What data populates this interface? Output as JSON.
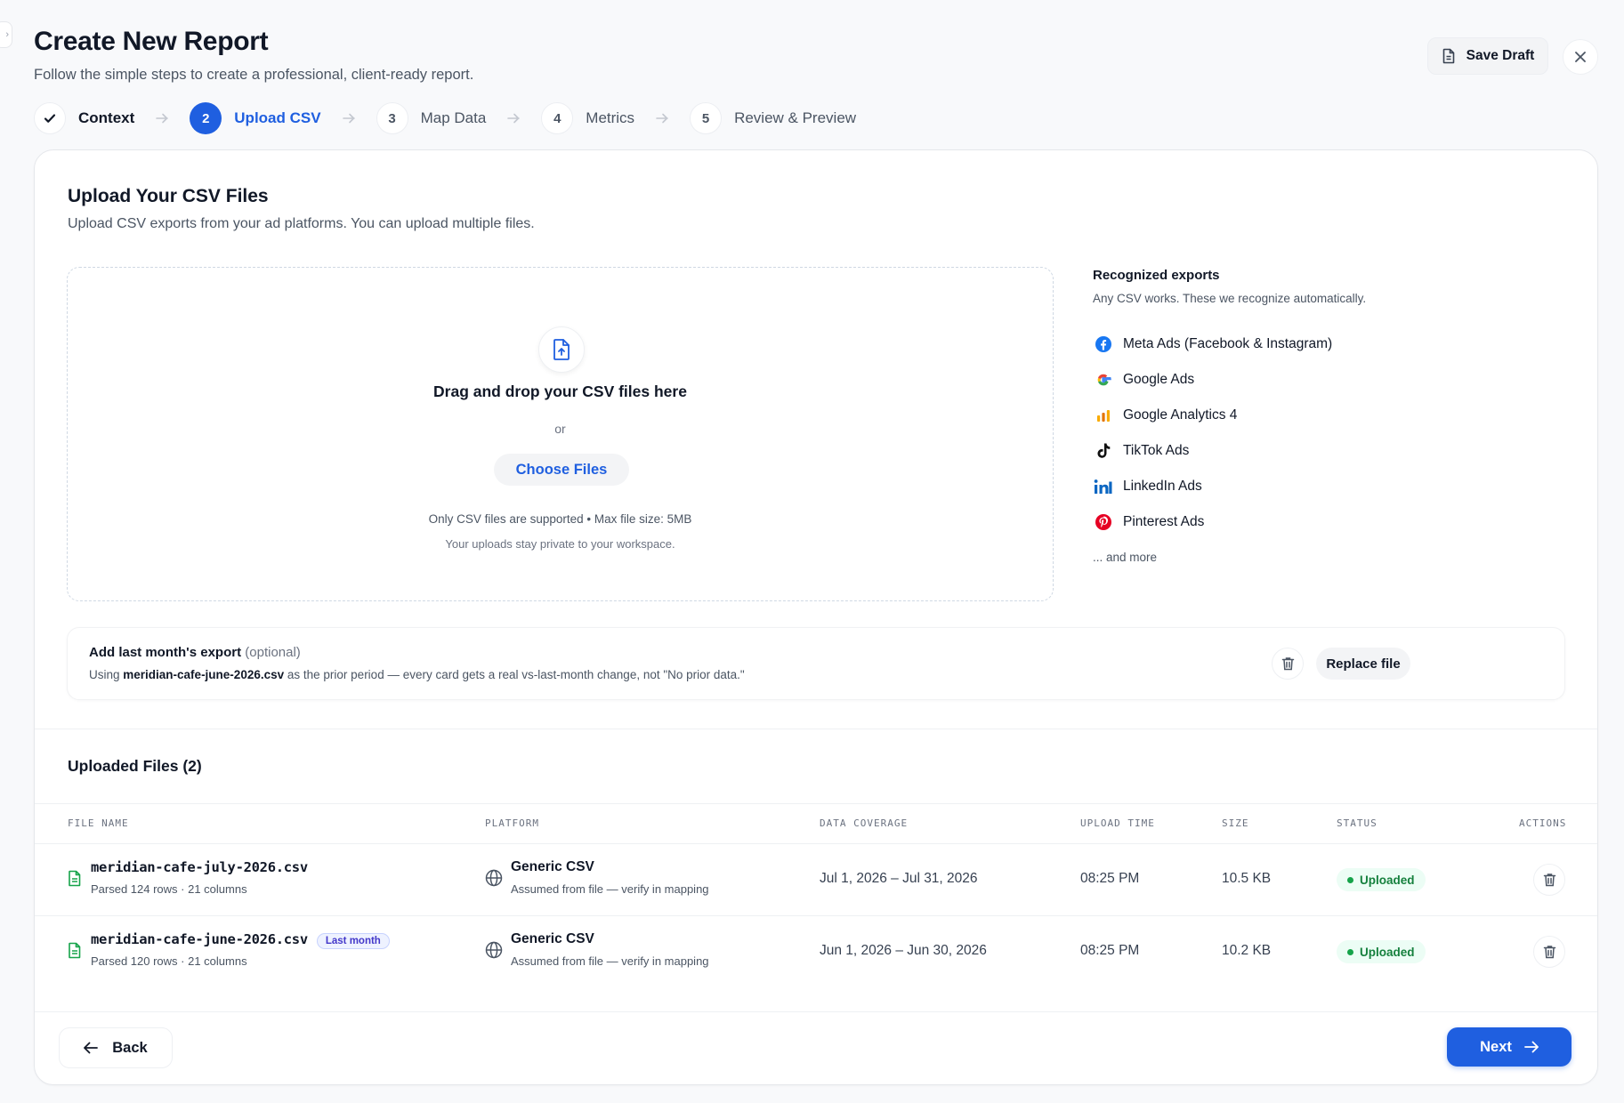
{
  "header": {
    "title": "Create New Report",
    "subtitle": "Follow the simple steps to create a professional, client-ready report.",
    "save_draft_label": "Save Draft",
    "close_icon": "close-icon"
  },
  "steps": [
    {
      "number": "✓",
      "label": "Context",
      "state": "done"
    },
    {
      "number": "2",
      "label": "Upload CSV",
      "state": "active"
    },
    {
      "number": "3",
      "label": "Map Data",
      "state": "pending"
    },
    {
      "number": "4",
      "label": "Metrics",
      "state": "pending"
    },
    {
      "number": "5",
      "label": "Review & Preview",
      "state": "pending"
    }
  ],
  "upload": {
    "title": "Upload Your CSV Files",
    "subtitle": "Upload CSV exports from your ad platforms. You can upload multiple files.",
    "dropzone": {
      "title": "Drag and drop your CSV files here",
      "or": "or",
      "choose_label": "Choose Files",
      "note_limits": "Only CSV files are supported • Max file size: 5MB",
      "note_privacy": "Your uploads stay private to your workspace."
    }
  },
  "recognized": {
    "title": "Recognized exports",
    "subtitle": "Any CSV works. These we recognize automatically.",
    "items": [
      {
        "label": "Meta Ads (Facebook & Instagram)",
        "icon": "meta-icon",
        "color": "#1877f2"
      },
      {
        "label": "Google Ads",
        "icon": "google-icon",
        "color": "#4285f4"
      },
      {
        "label": "Google Analytics 4",
        "icon": "analytics-icon",
        "color": "#f9ab00"
      },
      {
        "label": "TikTok Ads",
        "icon": "tiktok-icon",
        "color": "#111111"
      },
      {
        "label": "LinkedIn Ads",
        "icon": "linkedin-icon",
        "color": "#0a66c2"
      },
      {
        "label": "Pinterest Ads",
        "icon": "pinterest-icon",
        "color": "#e60023"
      }
    ],
    "more": "... and more"
  },
  "prior": {
    "title": "Add last month's export",
    "optional": "(optional)",
    "desc_prefix": "Using",
    "file": "meridian-cafe-june-2026.csv",
    "desc_suffix": "as the prior period — every card gets a real vs-last-month change, not \"No prior data.\"",
    "replace_label": "Replace file"
  },
  "files": {
    "title": "Uploaded Files (2)",
    "columns": [
      "FILE NAME",
      "PLATFORM",
      "DATA COVERAGE",
      "UPLOAD TIME",
      "SIZE",
      "STATUS",
      "ACTIONS"
    ],
    "rows": [
      {
        "name": "meridian-cafe-july-2026.csv",
        "badge": "",
        "parsed": "Parsed 124 rows · 21 columns",
        "platform": "Generic CSV",
        "platform_note": "Assumed from file — verify in mapping",
        "coverage": "Jul 1, 2026 – Jul 31, 2026",
        "time": "08:25 PM",
        "size": "10.5 KB",
        "status": "Uploaded"
      },
      {
        "name": "meridian-cafe-june-2026.csv",
        "badge": "Last month",
        "parsed": "Parsed 120 rows · 21 columns",
        "platform": "Generic CSV",
        "platform_note": "Assumed from file — verify in mapping",
        "coverage": "Jun 1, 2026 – Jun 30, 2026",
        "time": "08:25 PM",
        "size": "10.2 KB",
        "status": "Uploaded"
      }
    ]
  },
  "footer": {
    "back_label": "Back",
    "next_label": "Next"
  },
  "colors": {
    "accent": "#1f5fe0",
    "success": "#15803d",
    "background": "#f8f9fb"
  }
}
